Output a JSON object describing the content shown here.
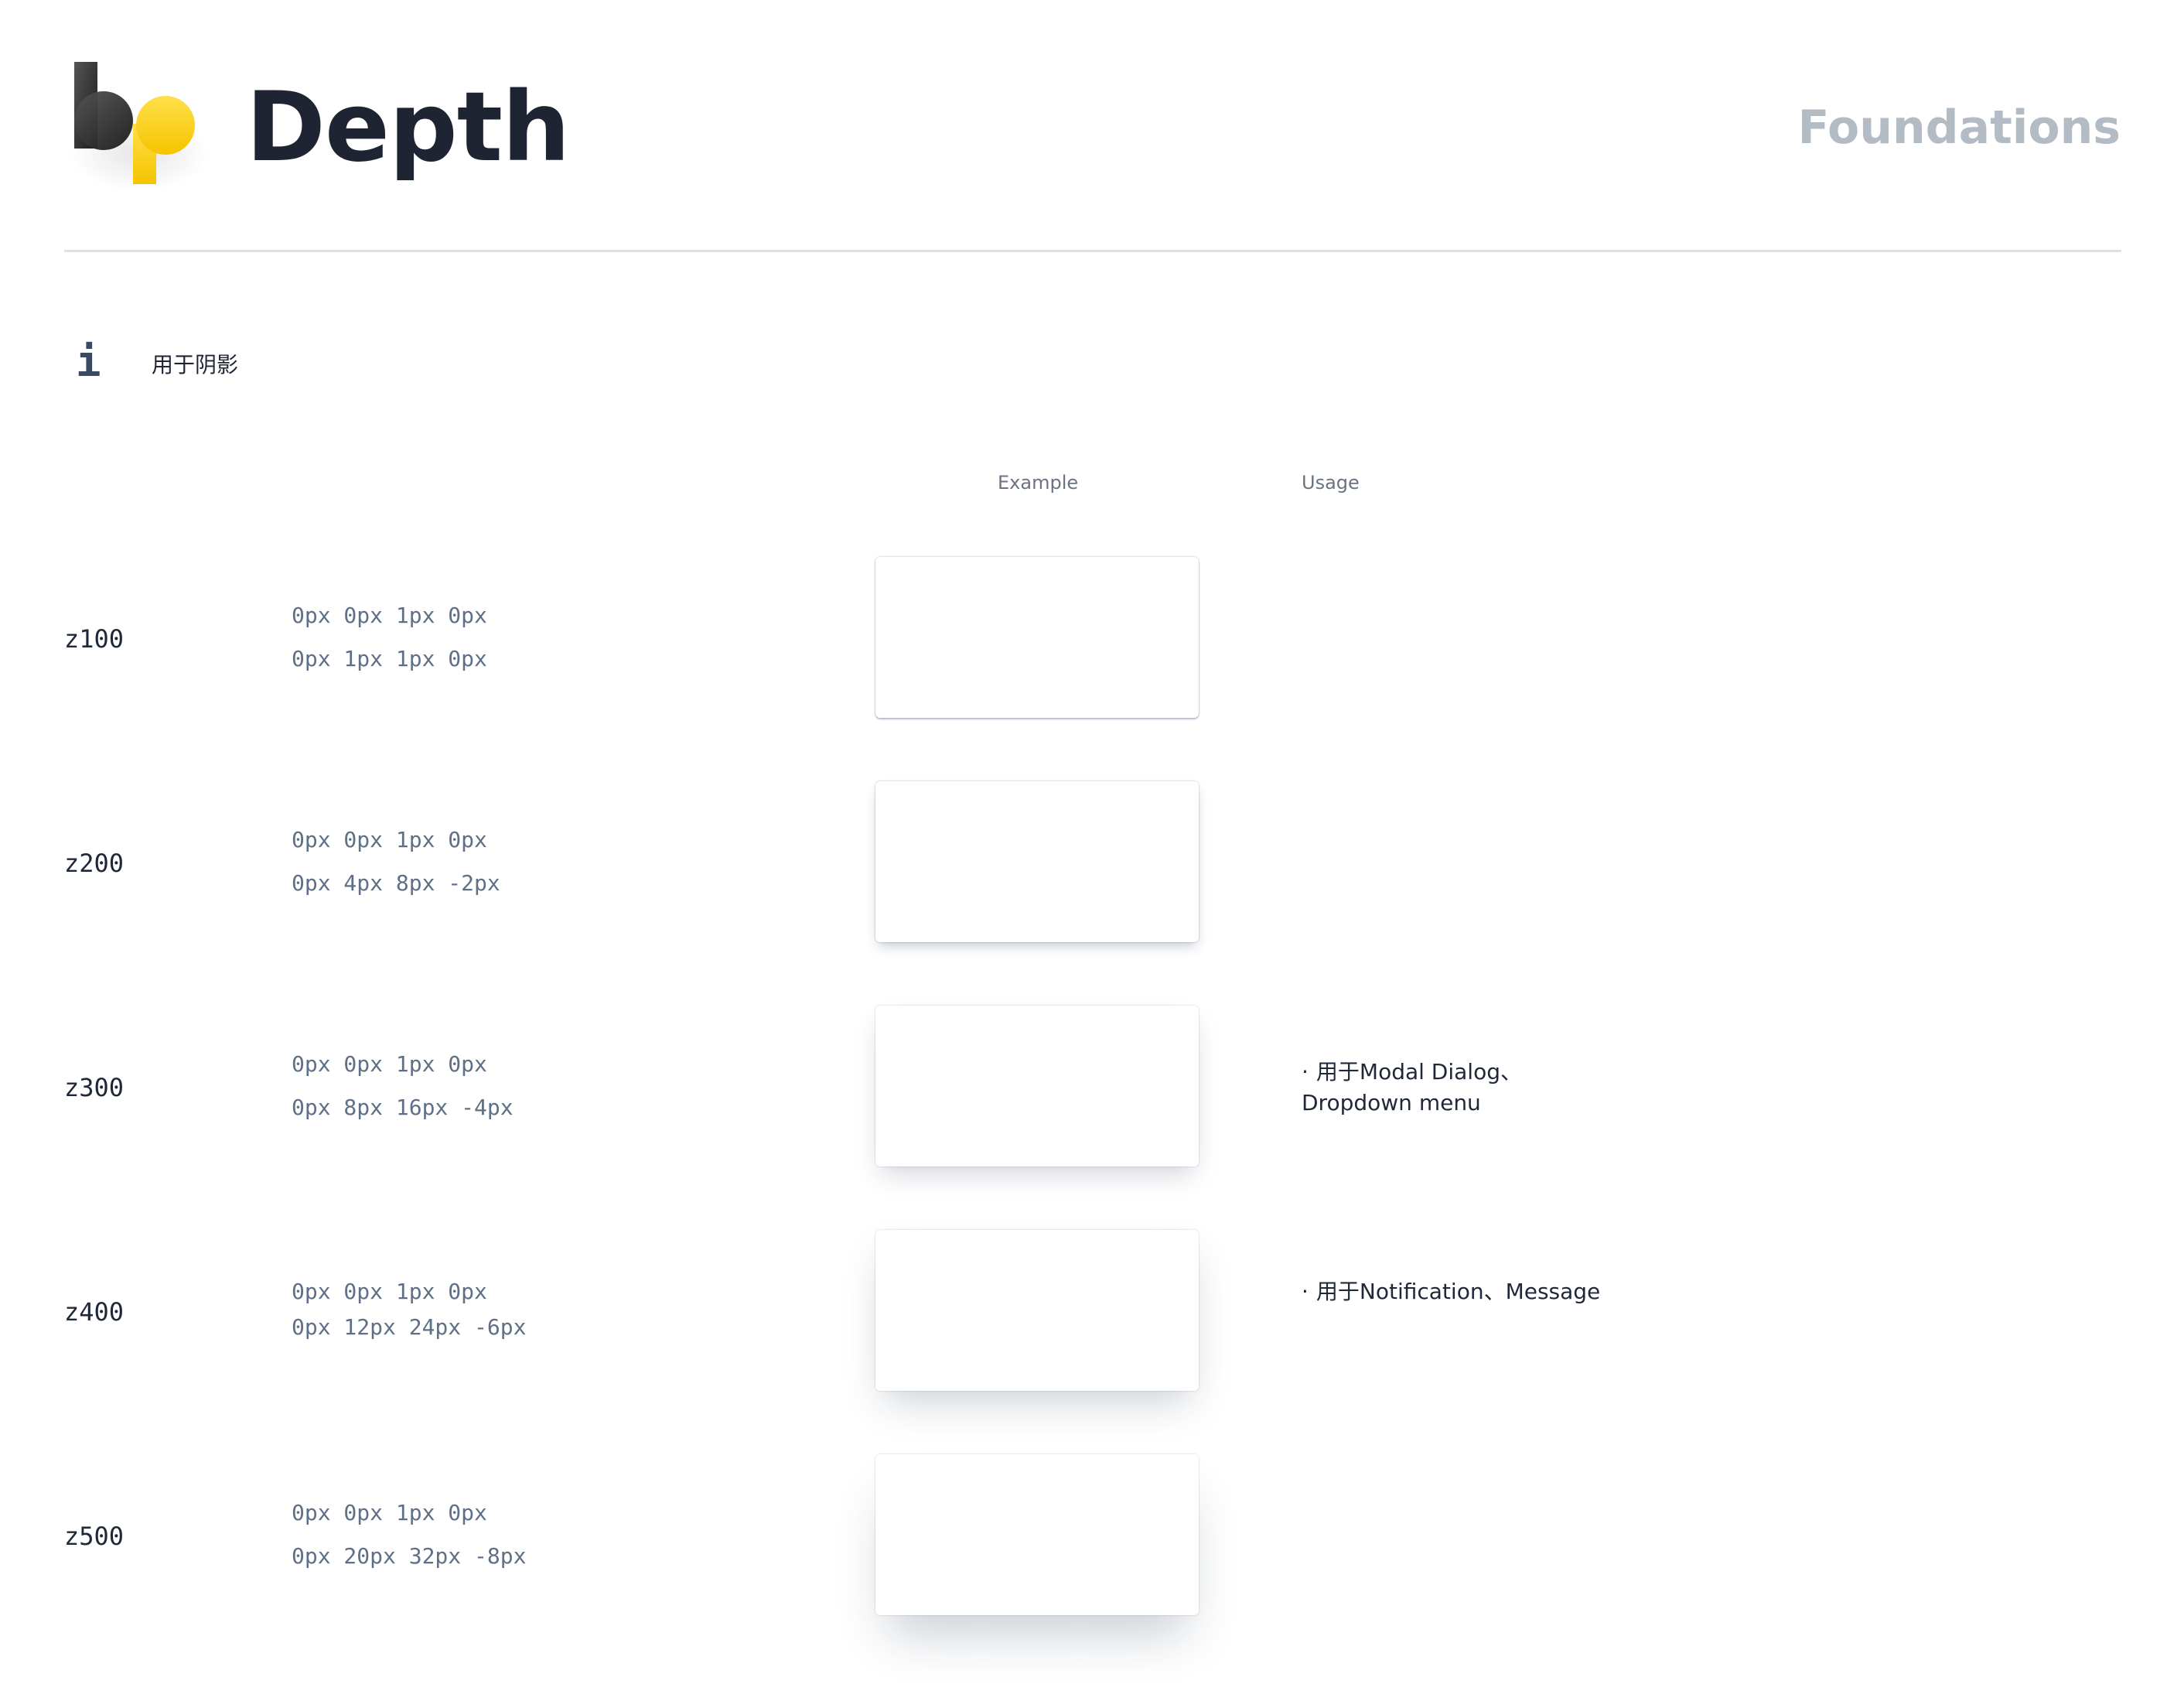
{
  "header": {
    "title": "Depth",
    "section": "Foundations"
  },
  "info": {
    "icon": "info-icon",
    "text": "用于阴影"
  },
  "columns": {
    "example": "Example",
    "usage": "Usage"
  },
  "tokens": [
    {
      "name": "z100",
      "shadow_1": "0px 0px 1px 0px",
      "shadow_2": "0px 1px 1px 0px",
      "usage_line_1": "",
      "usage_line_2": ""
    },
    {
      "name": "z200",
      "shadow_1": "0px 0px 1px 0px",
      "shadow_2": "0px 4px 8px -2px",
      "usage_line_1": "",
      "usage_line_2": ""
    },
    {
      "name": "z300",
      "shadow_1": "0px 0px 1px 0px",
      "shadow_2": "0px 8px 16px -4px",
      "usage_line_1": "用于Modal Dialog、",
      "usage_line_2": "Dropdown menu"
    },
    {
      "name": "z400",
      "shadow_1": "0px 0px 1px 0px",
      "shadow_2": "0px 12px 24px -6px",
      "usage_line_1": "用于Notification、Message",
      "usage_line_2": ""
    },
    {
      "name": "z500",
      "shadow_1": "0px 0px 1px 0px",
      "shadow_2": "0px 20px 32px -8px",
      "usage_line_1": "",
      "usage_line_2": ""
    }
  ],
  "colors": {
    "title": "#1e2432",
    "section_label": "#b3bbc5",
    "shadow_value": "#5e6f86",
    "logo_dark": "#2b2b2b",
    "logo_yellow": "#ffd21f"
  }
}
